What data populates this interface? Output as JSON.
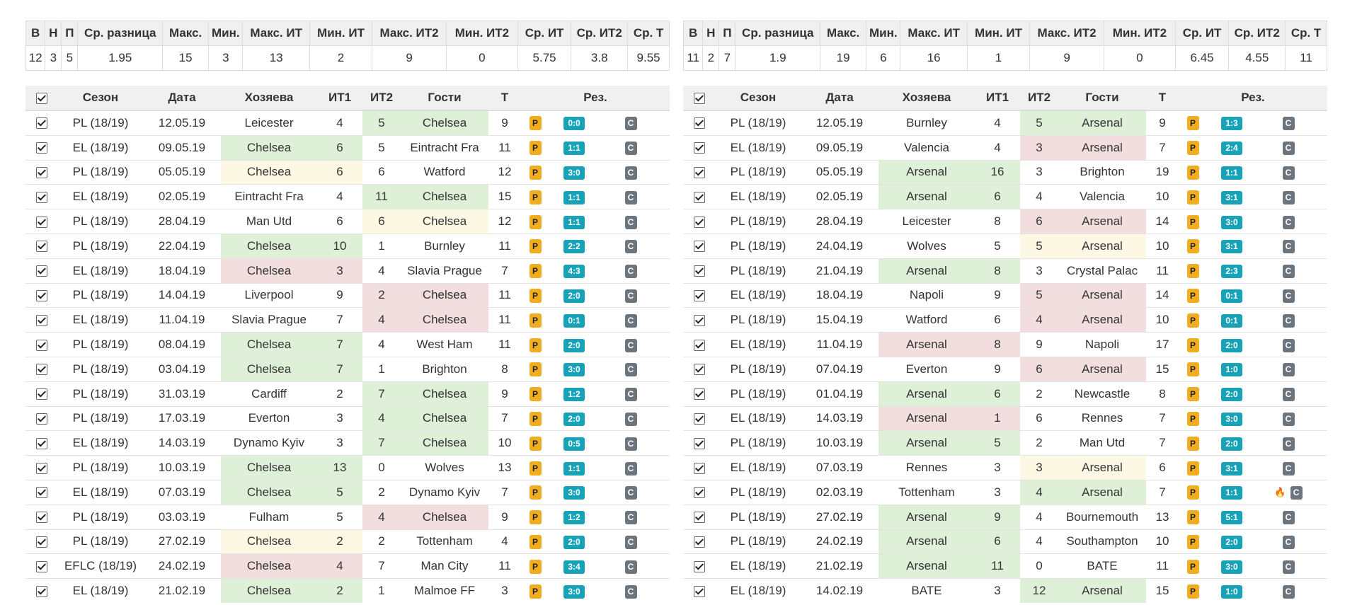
{
  "stats_headers": [
    "В",
    "Н",
    "П",
    "Ср. разница",
    "Макс.",
    "Мин.",
    "Макс. ИТ",
    "Мин. ИТ",
    "Макс. ИТ2",
    "Мин. ИТ2",
    "Ср. ИТ",
    "Ср. ИТ2",
    "Ср. Т"
  ],
  "match_headers": [
    "Сезон",
    "Дата",
    "Хозяева",
    "ИТ1",
    "ИТ2",
    "Гости",
    "Т",
    "Рез."
  ],
  "left": {
    "stats": [
      "12",
      "3",
      "5",
      "1.95",
      "15",
      "3",
      "13",
      "2",
      "9",
      "0",
      "5.75",
      "3.8",
      "9.55"
    ],
    "rows": [
      {
        "season": "PL (18/19)",
        "date": "12.05.19",
        "home": "Leicester",
        "it1": "4",
        "it2": "5",
        "away": "Chelsea",
        "t": "9",
        "res": "0:0",
        "hl": "",
        "al": "g",
        "fire": false
      },
      {
        "season": "EL (18/19)",
        "date": "09.05.19",
        "home": "Chelsea",
        "it1": "6",
        "it2": "5",
        "away": "Eintracht Fra",
        "t": "11",
        "res": "1:1",
        "hl": "g",
        "al": "",
        "fire": false
      },
      {
        "season": "PL (18/19)",
        "date": "05.05.19",
        "home": "Chelsea",
        "it1": "6",
        "it2": "6",
        "away": "Watford",
        "t": "12",
        "res": "3:0",
        "hl": "y",
        "al": "",
        "fire": false
      },
      {
        "season": "EL (18/19)",
        "date": "02.05.19",
        "home": "Eintracht Fra",
        "it1": "4",
        "it2": "11",
        "away": "Chelsea",
        "t": "15",
        "res": "1:1",
        "hl": "",
        "al": "g",
        "fire": false
      },
      {
        "season": "PL (18/19)",
        "date": "28.04.19",
        "home": "Man Utd",
        "it1": "6",
        "it2": "6",
        "away": "Chelsea",
        "t": "12",
        "res": "1:1",
        "hl": "",
        "al": "y",
        "fire": false
      },
      {
        "season": "PL (18/19)",
        "date": "22.04.19",
        "home": "Chelsea",
        "it1": "10",
        "it2": "1",
        "away": "Burnley",
        "t": "11",
        "res": "2:2",
        "hl": "g",
        "al": "",
        "fire": false
      },
      {
        "season": "EL (18/19)",
        "date": "18.04.19",
        "home": "Chelsea",
        "it1": "3",
        "it2": "4",
        "away": "Slavia Prague",
        "t": "7",
        "res": "4:3",
        "hl": "r",
        "al": "",
        "fire": false
      },
      {
        "season": "PL (18/19)",
        "date": "14.04.19",
        "home": "Liverpool",
        "it1": "9",
        "it2": "2",
        "away": "Chelsea",
        "t": "11",
        "res": "2:0",
        "hl": "",
        "al": "r",
        "fire": false
      },
      {
        "season": "EL (18/19)",
        "date": "11.04.19",
        "home": "Slavia Prague",
        "it1": "7",
        "it2": "4",
        "away": "Chelsea",
        "t": "11",
        "res": "0:1",
        "hl": "",
        "al": "r",
        "fire": false
      },
      {
        "season": "PL (18/19)",
        "date": "08.04.19",
        "home": "Chelsea",
        "it1": "7",
        "it2": "4",
        "away": "West Ham",
        "t": "11",
        "res": "2:0",
        "hl": "g",
        "al": "",
        "fire": false
      },
      {
        "season": "PL (18/19)",
        "date": "03.04.19",
        "home": "Chelsea",
        "it1": "7",
        "it2": "1",
        "away": "Brighton",
        "t": "8",
        "res": "3:0",
        "hl": "g",
        "al": "",
        "fire": false
      },
      {
        "season": "PL (18/19)",
        "date": "31.03.19",
        "home": "Cardiff",
        "it1": "2",
        "it2": "7",
        "away": "Chelsea",
        "t": "9",
        "res": "1:2",
        "hl": "",
        "al": "g",
        "fire": false
      },
      {
        "season": "PL (18/19)",
        "date": "17.03.19",
        "home": "Everton",
        "it1": "3",
        "it2": "4",
        "away": "Chelsea",
        "t": "7",
        "res": "2:0",
        "hl": "",
        "al": "g",
        "fire": false
      },
      {
        "season": "EL (18/19)",
        "date": "14.03.19",
        "home": "Dynamo Kyiv",
        "it1": "3",
        "it2": "7",
        "away": "Chelsea",
        "t": "10",
        "res": "0:5",
        "hl": "",
        "al": "g",
        "fire": false
      },
      {
        "season": "PL (18/19)",
        "date": "10.03.19",
        "home": "Chelsea",
        "it1": "13",
        "it2": "0",
        "away": "Wolves",
        "t": "13",
        "res": "1:1",
        "hl": "g",
        "al": "",
        "fire": false
      },
      {
        "season": "EL (18/19)",
        "date": "07.03.19",
        "home": "Chelsea",
        "it1": "5",
        "it2": "2",
        "away": "Dynamo Kyiv",
        "t": "7",
        "res": "3:0",
        "hl": "g",
        "al": "",
        "fire": false
      },
      {
        "season": "PL (18/19)",
        "date": "03.03.19",
        "home": "Fulham",
        "it1": "5",
        "it2": "4",
        "away": "Chelsea",
        "t": "9",
        "res": "1:2",
        "hl": "",
        "al": "r",
        "fire": false
      },
      {
        "season": "PL (18/19)",
        "date": "27.02.19",
        "home": "Chelsea",
        "it1": "2",
        "it2": "2",
        "away": "Tottenham",
        "t": "4",
        "res": "2:0",
        "hl": "y",
        "al": "",
        "fire": false
      },
      {
        "season": "EFLC (18/19)",
        "date": "24.02.19",
        "home": "Chelsea",
        "it1": "4",
        "it2": "7",
        "away": "Man City",
        "t": "11",
        "res": "3:4",
        "hl": "r",
        "al": "",
        "fire": false
      },
      {
        "season": "EL (18/19)",
        "date": "21.02.19",
        "home": "Chelsea",
        "it1": "2",
        "it2": "1",
        "away": "Malmoe FF",
        "t": "3",
        "res": "3:0",
        "hl": "g",
        "al": "",
        "fire": false
      }
    ]
  },
  "right": {
    "stats": [
      "11",
      "2",
      "7",
      "1.9",
      "19",
      "6",
      "16",
      "1",
      "9",
      "0",
      "6.45",
      "4.55",
      "11"
    ],
    "rows": [
      {
        "season": "PL (18/19)",
        "date": "12.05.19",
        "home": "Burnley",
        "it1": "4",
        "it2": "5",
        "away": "Arsenal",
        "t": "9",
        "res": "1:3",
        "hl": "",
        "al": "g",
        "fire": false
      },
      {
        "season": "EL (18/19)",
        "date": "09.05.19",
        "home": "Valencia",
        "it1": "4",
        "it2": "3",
        "away": "Arsenal",
        "t": "7",
        "res": "2:4",
        "hl": "",
        "al": "r",
        "fire": false
      },
      {
        "season": "PL (18/19)",
        "date": "05.05.19",
        "home": "Arsenal",
        "it1": "16",
        "it2": "3",
        "away": "Brighton",
        "t": "19",
        "res": "1:1",
        "hl": "g",
        "al": "",
        "fire": false
      },
      {
        "season": "EL (18/19)",
        "date": "02.05.19",
        "home": "Arsenal",
        "it1": "6",
        "it2": "4",
        "away": "Valencia",
        "t": "10",
        "res": "3:1",
        "hl": "g",
        "al": "",
        "fire": false
      },
      {
        "season": "PL (18/19)",
        "date": "28.04.19",
        "home": "Leicester",
        "it1": "8",
        "it2": "6",
        "away": "Arsenal",
        "t": "14",
        "res": "3:0",
        "hl": "",
        "al": "r",
        "fire": false
      },
      {
        "season": "PL (18/19)",
        "date": "24.04.19",
        "home": "Wolves",
        "it1": "5",
        "it2": "5",
        "away": "Arsenal",
        "t": "10",
        "res": "3:1",
        "hl": "",
        "al": "y",
        "fire": false
      },
      {
        "season": "PL (18/19)",
        "date": "21.04.19",
        "home": "Arsenal",
        "it1": "8",
        "it2": "3",
        "away": "Crystal Palac",
        "t": "11",
        "res": "2:3",
        "hl": "g",
        "al": "",
        "fire": false
      },
      {
        "season": "EL (18/19)",
        "date": "18.04.19",
        "home": "Napoli",
        "it1": "9",
        "it2": "5",
        "away": "Arsenal",
        "t": "14",
        "res": "0:1",
        "hl": "",
        "al": "r",
        "fire": false
      },
      {
        "season": "PL (18/19)",
        "date": "15.04.19",
        "home": "Watford",
        "it1": "6",
        "it2": "4",
        "away": "Arsenal",
        "t": "10",
        "res": "0:1",
        "hl": "",
        "al": "r",
        "fire": false
      },
      {
        "season": "EL (18/19)",
        "date": "11.04.19",
        "home": "Arsenal",
        "it1": "8",
        "it2": "9",
        "away": "Napoli",
        "t": "17",
        "res": "2:0",
        "hl": "r",
        "al": "",
        "fire": false
      },
      {
        "season": "PL (18/19)",
        "date": "07.04.19",
        "home": "Everton",
        "it1": "9",
        "it2": "6",
        "away": "Arsenal",
        "t": "15",
        "res": "1:0",
        "hl": "",
        "al": "r",
        "fire": false
      },
      {
        "season": "PL (18/19)",
        "date": "01.04.19",
        "home": "Arsenal",
        "it1": "6",
        "it2": "2",
        "away": "Newcastle",
        "t": "8",
        "res": "2:0",
        "hl": "g",
        "al": "",
        "fire": false
      },
      {
        "season": "EL (18/19)",
        "date": "14.03.19",
        "home": "Arsenal",
        "it1": "1",
        "it2": "6",
        "away": "Rennes",
        "t": "7",
        "res": "3:0",
        "hl": "r",
        "al": "",
        "fire": false
      },
      {
        "season": "PL (18/19)",
        "date": "10.03.19",
        "home": "Arsenal",
        "it1": "5",
        "it2": "2",
        "away": "Man Utd",
        "t": "7",
        "res": "2:0",
        "hl": "g",
        "al": "",
        "fire": false
      },
      {
        "season": "EL (18/19)",
        "date": "07.03.19",
        "home": "Rennes",
        "it1": "3",
        "it2": "3",
        "away": "Arsenal",
        "t": "6",
        "res": "3:1",
        "hl": "",
        "al": "y",
        "fire": false
      },
      {
        "season": "PL (18/19)",
        "date": "02.03.19",
        "home": "Tottenham",
        "it1": "3",
        "it2": "4",
        "away": "Arsenal",
        "t": "7",
        "res": "1:1",
        "hl": "",
        "al": "g",
        "fire": true
      },
      {
        "season": "PL (18/19)",
        "date": "27.02.19",
        "home": "Arsenal",
        "it1": "9",
        "it2": "4",
        "away": "Bournemouth",
        "t": "13",
        "res": "5:1",
        "hl": "g",
        "al": "",
        "fire": false
      },
      {
        "season": "PL (18/19)",
        "date": "24.02.19",
        "home": "Arsenal",
        "it1": "6",
        "it2": "4",
        "away": "Southampton",
        "t": "10",
        "res": "2:0",
        "hl": "g",
        "al": "",
        "fire": false
      },
      {
        "season": "EL (18/19)",
        "date": "21.02.19",
        "home": "Arsenal",
        "it1": "11",
        "it2": "0",
        "away": "BATE",
        "t": "11",
        "res": "3:0",
        "hl": "g",
        "al": "",
        "fire": false
      },
      {
        "season": "EL (18/19)",
        "date": "14.02.19",
        "home": "BATE",
        "it1": "3",
        "it2": "12",
        "away": "Arsenal",
        "t": "15",
        "res": "1:0",
        "hl": "",
        "al": "g",
        "fire": false
      }
    ]
  },
  "badges": {
    "p": "P",
    "c": "C"
  },
  "icons": {
    "checkbox": "checkbox-checked-icon",
    "fire": "fire-icon"
  }
}
